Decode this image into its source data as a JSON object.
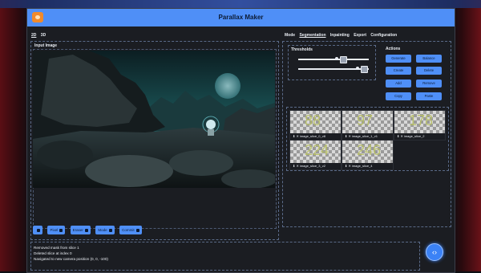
{
  "window": {
    "title": "Parallax Maker"
  },
  "mode_toggle": {
    "opt_2d": "2D",
    "opt_3d": "3D"
  },
  "input_panel": {
    "label": "Input Image"
  },
  "image_toolbar": {
    "buttons": [
      {
        "label": "",
        "icon": "crop-icon"
      },
      {
        "label": "Pixel",
        "icon": "pixel-icon"
      },
      {
        "label": "Eraser",
        "icon": "eraser-icon"
      },
      {
        "label": "Mode",
        "icon": "mode-icon"
      },
      {
        "label": "Commit",
        "icon": "commit-icon"
      }
    ]
  },
  "tabs": [
    "Mode",
    "Segmentation",
    "Inpainting",
    "Export",
    "Configuration"
  ],
  "active_tab": "Segmentation",
  "thresholds": {
    "label": "Thresholds",
    "slider1_value": 0.55,
    "slider2_value": 0.85
  },
  "actions": {
    "label": "Actions",
    "buttons": [
      {
        "label": "Generate",
        "icon": "image-icon"
      },
      {
        "label": "Balance",
        "icon": "balance-icon"
      },
      {
        "label": "Create",
        "icon": "create-icon"
      },
      {
        "label": "Delete",
        "icon": "trash-icon"
      },
      {
        "label": "Add",
        "icon": "add-icon"
      },
      {
        "label": "Remove",
        "icon": "remove-icon"
      },
      {
        "label": "Copy",
        "icon": "copy-icon"
      },
      {
        "label": "Paste",
        "icon": "paste-icon"
      }
    ]
  },
  "slices": [
    {
      "num": "88",
      "caption": "⬇ ✕ image_slice_0_v8"
    },
    {
      "num": "97",
      "caption": "⬇ ✕ image_slice_1_v1"
    },
    {
      "num": "178",
      "caption": "⬇ ✕ image_slice_2"
    },
    {
      "num": "224",
      "caption": "⬇ ✕ image_slice_3_v2"
    },
    {
      "num": "246",
      "caption": "⬇ ✕ image_slice_4"
    }
  ],
  "log": [
    "Removed mask from slice 1",
    "Deleted slice at index 0",
    "Navigated to new camera position (0, 0, -100)"
  ],
  "fab": {
    "glyph": "‹›"
  },
  "colors": {
    "accent": "#4f8ff7",
    "bg": "#1b1d22",
    "titlebar": "#4f8ff7"
  }
}
